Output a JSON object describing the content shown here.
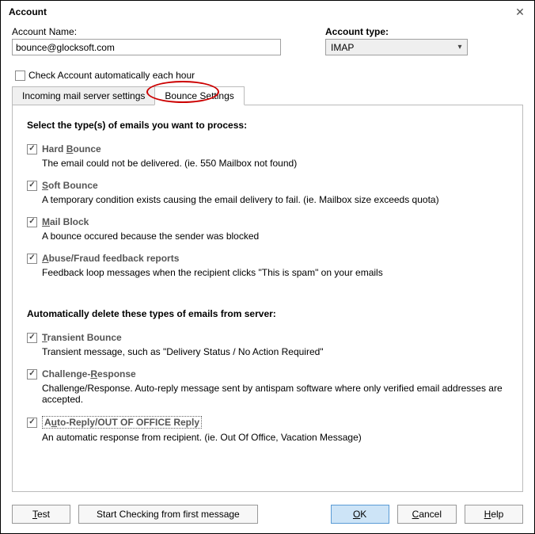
{
  "window": {
    "title": "Account"
  },
  "fields": {
    "account_name_label": "Account Name:",
    "account_name_value": "bounce@glocksoft.com",
    "account_type_label": "Account type:",
    "account_type_value": "IMAP"
  },
  "auto_check": {
    "label": "Check Account automatically each hour"
  },
  "tabs": {
    "incoming": "Incoming mail server settings",
    "bounce": "Bounce Settings"
  },
  "section1": {
    "title": "Select the type(s) of emails you want to process:",
    "hard_bounce": {
      "pre": "Hard ",
      "u": "B",
      "post": "ounce",
      "desc": "The email could not be delivered. (ie. 550 Mailbox not found)"
    },
    "soft_bounce": {
      "u": "S",
      "post": "oft Bounce",
      "desc": "A temporary condition exists causing the email delivery to fail. (ie. Mailbox size exceeds quota)"
    },
    "mail_block": {
      "u": "M",
      "post": "ail Block",
      "desc": "A bounce occured because the sender was blocked"
    },
    "abuse": {
      "u": "A",
      "post": "buse/Fraud feedback reports",
      "desc": "Feedback loop messages when the recipient clicks \"This is spam\" on your emails"
    }
  },
  "section2": {
    "title": "Automatically delete these types of emails from server:",
    "transient": {
      "u": "T",
      "post": "ransient Bounce",
      "desc": "Transient message, such as \"Delivery Status / No Action Required\""
    },
    "challenge": {
      "pre": "Challenge-",
      "u": "R",
      "post": "esponse",
      "desc": "Challenge/Response. Auto-reply message sent by antispam software where only verified email addresses are accepted."
    },
    "autoreply": {
      "pre": "A",
      "u": "u",
      "post": "to-Reply/OUT OF OFFICE Reply",
      "desc": "An automatic response from recipient. (ie. Out Of Office, Vacation Message)"
    }
  },
  "buttons": {
    "test": {
      "u": "T",
      "post": "est"
    },
    "start": "Start Checking from first message",
    "ok": {
      "u": "O",
      "post": "K"
    },
    "cancel": {
      "u": "C",
      "post": "ancel"
    },
    "help": {
      "u": "H",
      "post": "elp"
    }
  }
}
